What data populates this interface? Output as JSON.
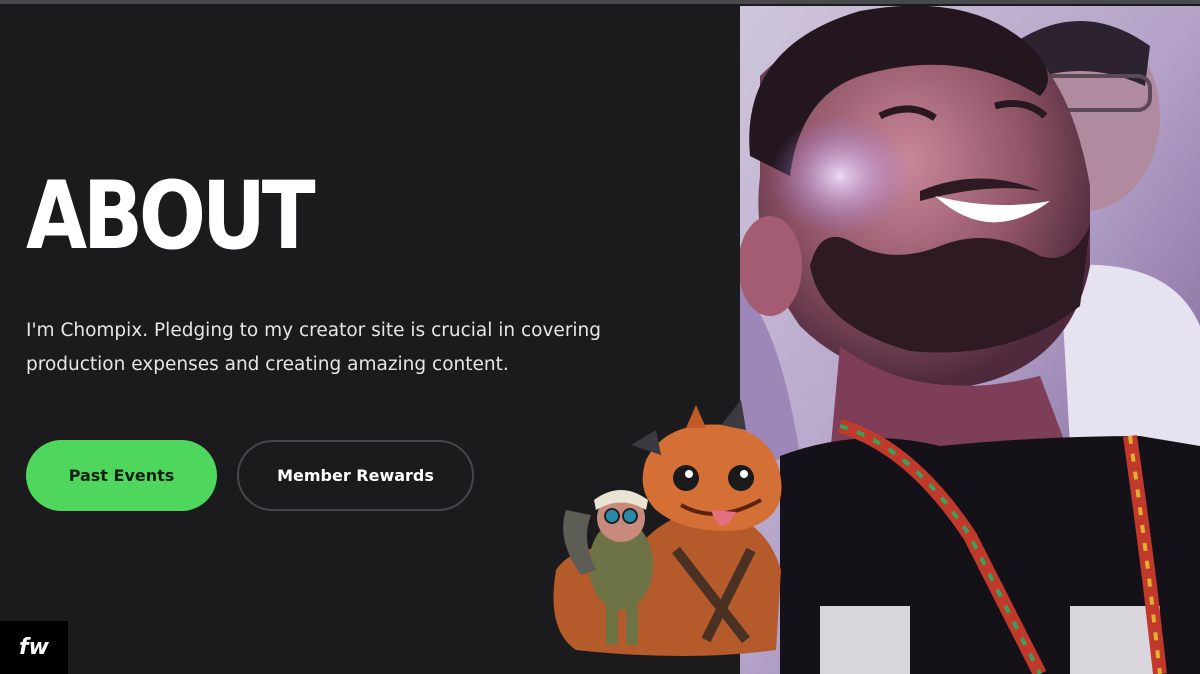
{
  "about": {
    "title": "ABOUT",
    "description": "I'm Chompix. Pledging to my creator site is crucial in covering production expenses and creating amazing content."
  },
  "buttons": {
    "past_events": "Past Events",
    "member_rewards": "Member Rewards"
  },
  "watermark": {
    "text": "fw"
  },
  "colors": {
    "background": "#1b1b1e",
    "accent": "#4ed75c",
    "secondary_border": "#47474b"
  }
}
